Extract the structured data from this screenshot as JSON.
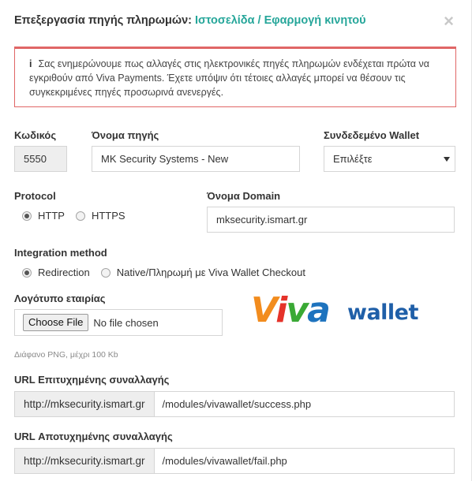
{
  "modal": {
    "title_prefix": "Επεξεργασία πηγής πληρωμών:",
    "title_accent": "Ιστοσελίδα / Εφαρμογή κινητού",
    "close_symbol": "×"
  },
  "alert": {
    "icon": "i",
    "text": "Σας ενημερώνουμε πως αλλαγές στις ηλεκτρονικές πηγές πληρωμών ενδέχεται πρώτα να εγκριθούν από Viva Payments. Έχετε υπόψιν ότι τέτοιες αλλαγές μπορεί να θέσουν τις συγκεκριμένες πηγές προσωρινά ανενεργές.",
    "color": "#e06666"
  },
  "fields": {
    "code": {
      "label": "Κωδικός",
      "value": "5550"
    },
    "source_name": {
      "label": "Όνομα πηγής",
      "value": "MK Security Systems - New"
    },
    "wallet": {
      "label": "Συνδεδεμένο Wallet",
      "value": "Επιλέξτε"
    },
    "protocol": {
      "label": "Protocol",
      "options": [
        "HTTP",
        "HTTPS"
      ],
      "selected": "HTTP"
    },
    "domain": {
      "label": "Όνομα Domain",
      "value": "mksecurity.ismart.gr"
    },
    "integration": {
      "label": "Integration method",
      "options": [
        "Redirection",
        "Native/Πληρωμή με Viva Wallet Checkout"
      ],
      "selected": "Redirection"
    },
    "logo": {
      "label": "Λογότυπο εταιρίας",
      "button": "Choose File",
      "status": "No file chosen",
      "hint": "Διάφανο PNG, μέχρι 100 Kb"
    },
    "success_url": {
      "label": "URL Επιτυχημένης συναλλαγής",
      "prefix": "http://mksecurity.ismart.gr",
      "path": "/modules/vivawallet/success.php"
    },
    "fail_url": {
      "label": "URL Αποτυχημένης συναλλαγής",
      "prefix": "http://mksecurity.ismart.gr",
      "path": "/modules/vivawallet/fail.php"
    }
  },
  "brand_logo": {
    "script_letters": [
      "V",
      "i",
      "v",
      "a"
    ],
    "word": "wallet",
    "colors": [
      "#f28c1e",
      "#e5332a",
      "#3aa935",
      "#1e73be",
      "#1f5fa8"
    ]
  },
  "theme": {
    "accent": "#26a69a",
    "readonly_bg": "#eeeeee",
    "border": "#d5d5d5"
  }
}
